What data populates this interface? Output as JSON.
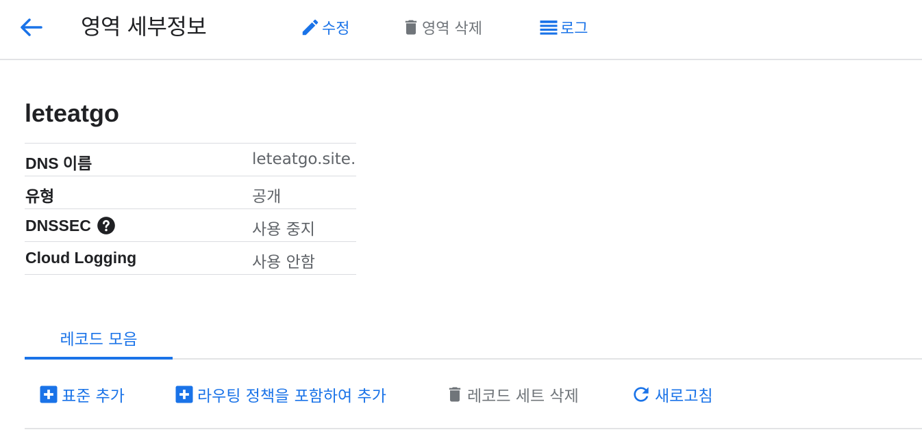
{
  "header": {
    "title": "영역 세부정보",
    "back_icon": "arrow-back-icon",
    "actions": {
      "edit": "수정",
      "delete_zone": "영역 삭제",
      "logs": "로그"
    }
  },
  "zone": {
    "name": "leteatgo",
    "details": [
      {
        "label": "DNS 이름",
        "value": "leteatgo.site."
      },
      {
        "label": "유형",
        "value": "공개"
      },
      {
        "label": "DNSSEC",
        "value": "사용 중지"
      },
      {
        "label": "Cloud Logging",
        "value": "사용 안함"
      }
    ]
  },
  "tabs": [
    {
      "label": "레코드 모음",
      "active": true
    }
  ],
  "recordset_actions": {
    "add_standard": "표준 추가",
    "add_with_routing": "라우팅 정책을 포함하여 추가",
    "delete_recordset": "레코드 세트 삭제",
    "refresh": "새로고침"
  },
  "colors": {
    "accent": "#1a73e8",
    "disabled": "#70757a",
    "divider": "#dadce0"
  }
}
